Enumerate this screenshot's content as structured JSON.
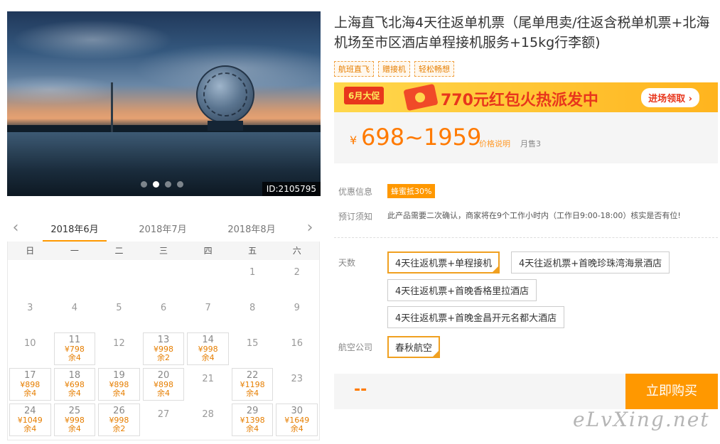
{
  "hero": {
    "id_badge": "ID:2105795",
    "dots": 4,
    "active_dot": 1
  },
  "calendar": {
    "prev_arrow": "‹",
    "next_arrow": "›",
    "months": [
      "2018年6月",
      "2018年7月",
      "2018年8月"
    ],
    "active_month": 0,
    "weekdays": [
      "日",
      "一",
      "二",
      "三",
      "四",
      "五",
      "六"
    ],
    "weeks": [
      [
        null,
        null,
        null,
        null,
        null,
        {
          "d": "1"
        },
        {
          "d": "2"
        }
      ],
      [
        {
          "d": "3"
        },
        {
          "d": "4"
        },
        {
          "d": "5"
        },
        {
          "d": "6"
        },
        {
          "d": "7"
        },
        {
          "d": "8"
        },
        {
          "d": "9"
        }
      ],
      [
        {
          "d": "10"
        },
        {
          "d": "11",
          "p": "¥798",
          "s": "余4"
        },
        {
          "d": "12"
        },
        {
          "d": "13",
          "p": "¥998",
          "s": "余2"
        },
        {
          "d": "14",
          "p": "¥998",
          "s": "余4"
        },
        {
          "d": "15"
        },
        {
          "d": "16"
        }
      ],
      [
        {
          "d": "17",
          "p": "¥898",
          "s": "余4"
        },
        {
          "d": "18",
          "p": "¥698",
          "s": "余4"
        },
        {
          "d": "19",
          "p": "¥898",
          "s": "余4"
        },
        {
          "d": "20",
          "p": "¥898",
          "s": "余4"
        },
        {
          "d": "21"
        },
        {
          "d": "22",
          "p": "¥1198",
          "s": "余4"
        },
        {
          "d": "23"
        }
      ],
      [
        {
          "d": "24",
          "p": "¥1049",
          "s": "余4"
        },
        {
          "d": "25",
          "p": "¥998",
          "s": "余4"
        },
        {
          "d": "26",
          "p": "¥998",
          "s": "余2"
        },
        {
          "d": "27"
        },
        {
          "d": "28"
        },
        {
          "d": "29",
          "p": "¥1398",
          "s": "余4"
        },
        {
          "d": "30",
          "p": "¥1649",
          "s": "余4"
        }
      ]
    ]
  },
  "product": {
    "title": "上海直飞北海4天往返单机票（尾单甩卖/往返含税单机票+北海机场至市区酒店单程接机服务+15kg行李额)",
    "tags": [
      "航班直飞",
      "赠接机",
      "轻松畅想"
    ]
  },
  "promo": {
    "badge": "6月大促",
    "text": "770元红包火热派发中",
    "button": "进场领取 ›"
  },
  "price": {
    "yen": "¥",
    "range": "698~1959",
    "note": "价格说明",
    "sales": "月售3"
  },
  "info": {
    "discount_label": "优惠信息",
    "discount_badge": "蜂蜜抵30%",
    "notice_label": "预订须知",
    "notice_text": "此产品需要二次确认，商家将在9个工作小时内（工作日9:00-18:00）核实是否有位!"
  },
  "options": {
    "days_label": "天数",
    "days": [
      "4天往返机票+单程接机",
      "4天往返机票+首晚珍珠湾海景酒店",
      "4天往返机票+首晚香格里拉酒店",
      "4天往返机票+首晚金昌开元名都大酒店"
    ],
    "selected_day": 0,
    "airline_label": "航空公司",
    "airlines": [
      "春秋航空"
    ]
  },
  "buy": {
    "price": "--",
    "button": "立即购买"
  },
  "watermark": "eLvXing.net",
  "colors": {
    "accent": "#ff9800",
    "price": "#ff7a00",
    "promo_red": "#e8361c"
  }
}
